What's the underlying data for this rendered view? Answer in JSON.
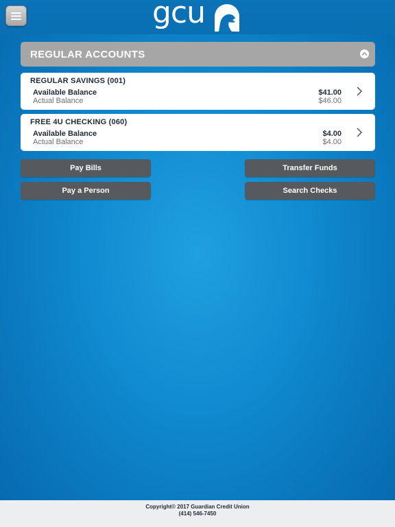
{
  "header": {
    "menu_icon": "hamburger-menu-icon",
    "logo_text": "gcu",
    "logo_mark": "eagle-head-icon"
  },
  "colors": {
    "background": "#118cd2",
    "section_header": "#a6a6a6",
    "button": "#56595d",
    "card": "#ffffff"
  },
  "section": {
    "title": "REGULAR ACCOUNTS",
    "toggle_icon": "chevron-up-circle-icon"
  },
  "accounts": [
    {
      "name": "REGULAR SAVINGS (001)",
      "available_label": "Available Balance",
      "available_value": "$41.00",
      "actual_label": "Actual Balance",
      "actual_value": "$46.00"
    },
    {
      "name": "FREE 4U CHECKING (060)",
      "available_label": "Available Balance",
      "available_value": "$4.00",
      "actual_label": "Actual Balance",
      "actual_value": "$4.00"
    }
  ],
  "actions": {
    "pay_bills": "Pay Bills",
    "transfer_funds": "Transfer Funds",
    "pay_person": "Pay a Person",
    "search_checks": "Search Checks"
  },
  "footer": {
    "copyright": "Copyright© 2017 Guardian Credit Union",
    "phone": "(414) 546-7450"
  }
}
